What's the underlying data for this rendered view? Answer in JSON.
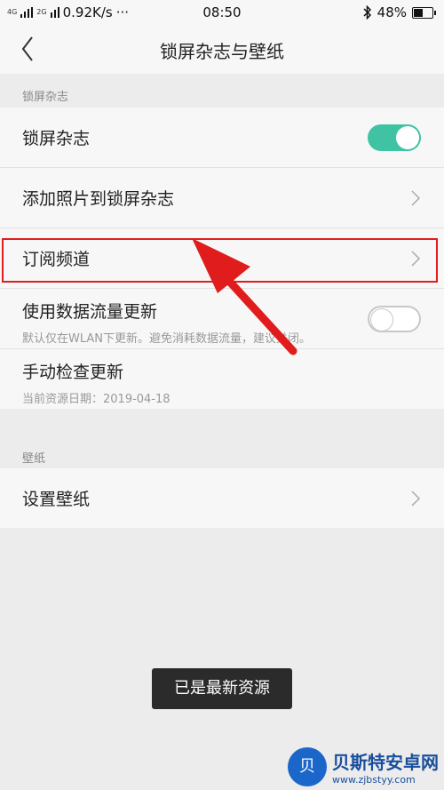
{
  "status": {
    "network": "4G",
    "network2": "2G",
    "speed": "0.92K/s",
    "dots": "···",
    "time": "08:50",
    "battery": "48%",
    "battery_level": 0.48
  },
  "header": {
    "title": "锁屏杂志与壁纸"
  },
  "sections": [
    {
      "label": "锁屏杂志"
    },
    {
      "label": "壁纸"
    }
  ],
  "rows": {
    "magazine": {
      "label": "锁屏杂志",
      "enabled": true
    },
    "add_photos": {
      "label": "添加照片到锁屏杂志"
    },
    "subscribe": {
      "label": "订阅频道"
    },
    "data_update": {
      "label": "使用数据流量更新",
      "sub": "默认仅在WLAN下更新。避免消耗数据流量，建议关闭。",
      "enabled": false
    },
    "manual_check": {
      "label": "手动检查更新",
      "sub": "当前资源日期：2019-04-18"
    },
    "wallpaper": {
      "label": "设置壁纸"
    }
  },
  "toast": "已是最新资源",
  "watermark": {
    "title": "贝斯特安卓网",
    "url": "www.zjbstyy.com",
    "logo_char": "贝"
  },
  "colors": {
    "toggle_on": "#3fc3a3",
    "highlight": "#e01c1c",
    "arrow": "#e01c1c"
  }
}
